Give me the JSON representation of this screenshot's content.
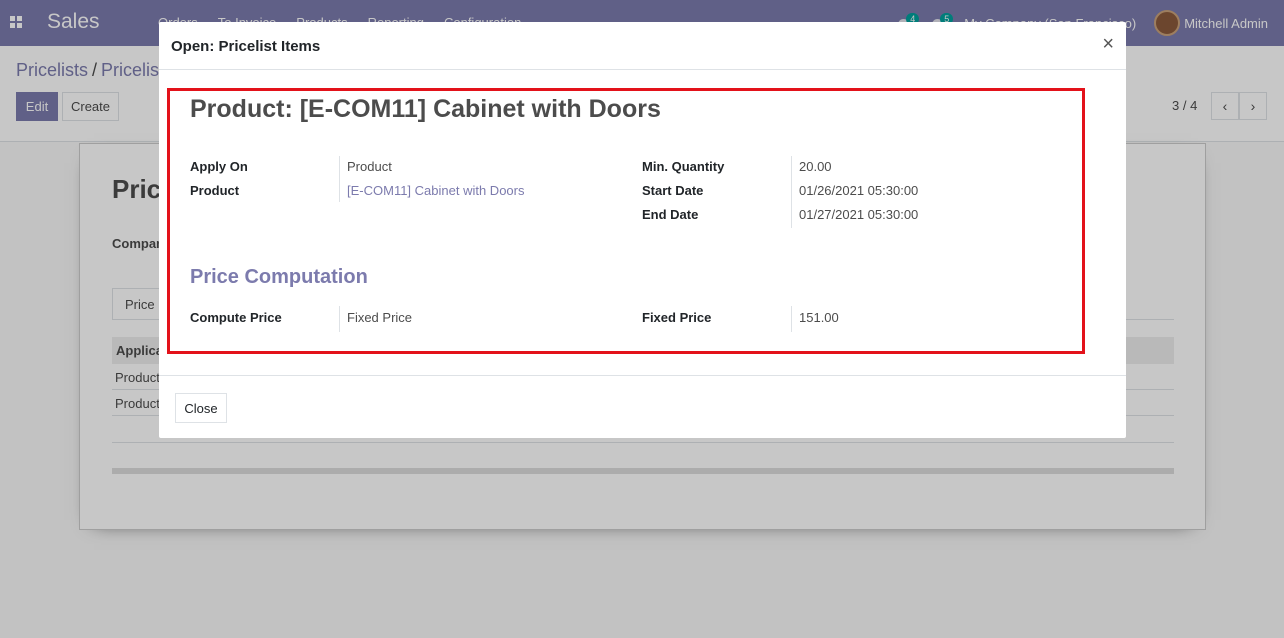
{
  "navbar": {
    "app_name": "Sales",
    "menu": [
      "Orders",
      "To Invoice",
      "Products",
      "Reporting",
      "Configuration"
    ],
    "activity_count": "4",
    "messages_count": "5",
    "company": "My Company (San Francisco)",
    "user": "Mitchell Admin"
  },
  "control_panel": {
    "breadcrumb_root": "Pricelists",
    "breadcrumb_sep": "/",
    "breadcrumb_current": "Pricelis",
    "edit_label": "Edit",
    "create_label": "Create",
    "pager": "3 / 4",
    "prev_glyph": "‹",
    "next_glyph": "›"
  },
  "sheet": {
    "title": "Pric",
    "company_label": "Compan",
    "tab_label": "Price l",
    "col_header": "Applica",
    "rows": [
      "Product",
      "Product"
    ]
  },
  "dialog": {
    "title": "Open: Pricelist Items",
    "close_glyph": "×",
    "record_title": "Product: [E-COM11] Cabinet with Doors",
    "fields_left": [
      {
        "label": "Apply On",
        "value": "Product",
        "link": false
      },
      {
        "label": "Product",
        "value": "[E-COM11] Cabinet with Doors",
        "link": true
      }
    ],
    "fields_right": [
      {
        "label": "Min. Quantity",
        "value": "20.00"
      },
      {
        "label": "Start Date",
        "value": "01/26/2021 05:30:00"
      },
      {
        "label": "End Date",
        "value": "01/27/2021 05:30:00"
      }
    ],
    "section_title": "Price Computation",
    "compute": {
      "label": "Compute Price",
      "value": "Fixed Price",
      "fixed_label": "Fixed Price",
      "fixed_value": "151.00"
    },
    "close_button": "Close"
  },
  "colors": {
    "brand": "#7c7bad",
    "highlight": "#e3121a",
    "badge": "#00a09d"
  }
}
